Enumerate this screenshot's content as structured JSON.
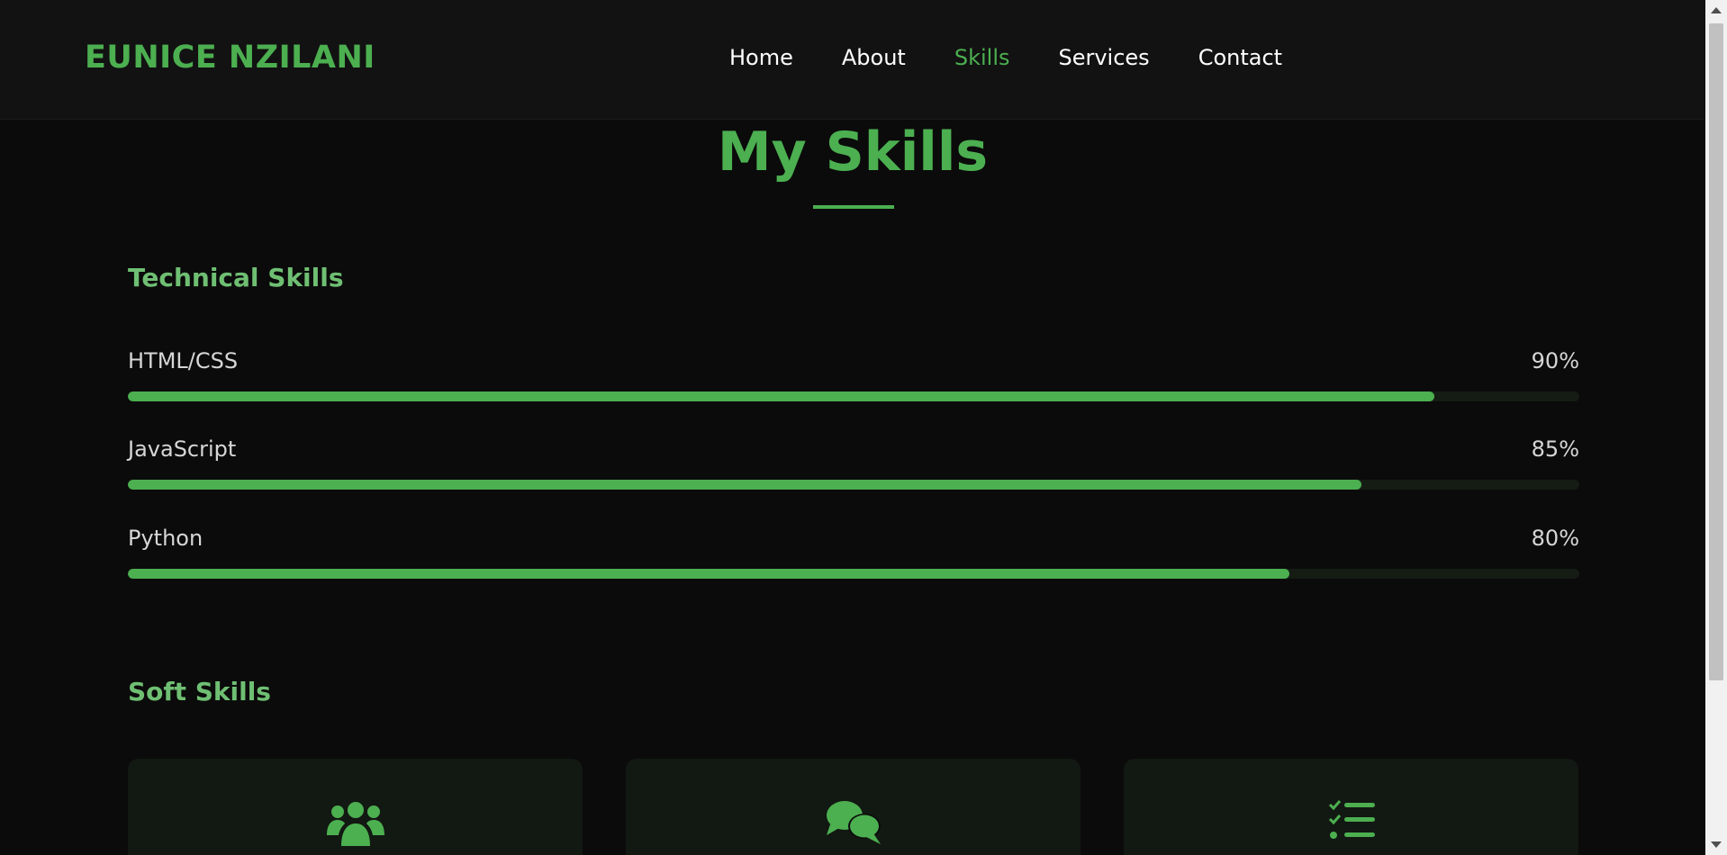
{
  "header": {
    "brand": "EUNICE NZILANI",
    "nav": [
      {
        "label": "Home",
        "active": false
      },
      {
        "label": "About",
        "active": false
      },
      {
        "label": "Skills",
        "active": true
      },
      {
        "label": "Services",
        "active": false
      },
      {
        "label": "Contact",
        "active": false
      }
    ]
  },
  "section": {
    "title": "My Skills"
  },
  "technical": {
    "heading": "Technical Skills",
    "skills": [
      {
        "name": "HTML/CSS",
        "percent_label": "90%",
        "level": 0.9
      },
      {
        "name": "JavaScript",
        "percent_label": "85%",
        "level": 0.85
      },
      {
        "name": "Python",
        "percent_label": "80%",
        "level": 0.8
      }
    ]
  },
  "soft": {
    "heading": "Soft Skills",
    "cards": [
      {
        "icon": "users-icon"
      },
      {
        "icon": "comments-icon"
      },
      {
        "icon": "tasks-list-icon"
      }
    ]
  },
  "colors": {
    "accent": "#4caf50",
    "background": "#0b0b0b",
    "header_background": "#121212",
    "card_background": "#121812",
    "text": "#d6d6d6"
  }
}
